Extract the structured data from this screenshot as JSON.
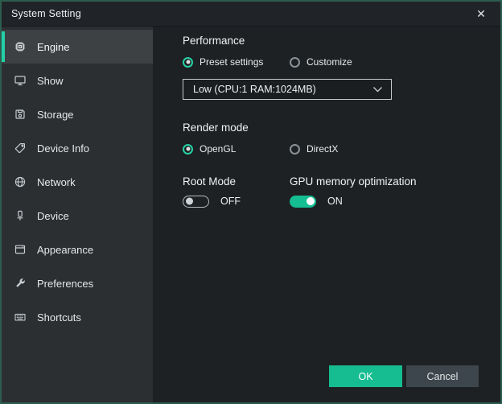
{
  "window": {
    "title": "System Setting",
    "close_icon": "✕"
  },
  "colors": {
    "accent": "#23d1a5",
    "ok_button": "#16bd90",
    "cancel_button": "#3d464d",
    "window_border": "#2c5d4e",
    "sidebar_bg": "#2b2f32",
    "main_bg": "#1d2124"
  },
  "sidebar": {
    "items": [
      {
        "label": "Engine",
        "icon": "engine-chip-icon",
        "selected": true
      },
      {
        "label": "Show",
        "icon": "monitor-icon",
        "selected": false
      },
      {
        "label": "Storage",
        "icon": "floppy-disk-icon",
        "selected": false
      },
      {
        "label": "Device Info",
        "icon": "tag-icon",
        "selected": false
      },
      {
        "label": "Network",
        "icon": "globe-icon",
        "selected": false
      },
      {
        "label": "Device",
        "icon": "usb-device-icon",
        "selected": false
      },
      {
        "label": "Appearance",
        "icon": "window-icon",
        "selected": false
      },
      {
        "label": "Preferences",
        "icon": "wrench-icon",
        "selected": false
      },
      {
        "label": "Shortcuts",
        "icon": "keyboard-icon",
        "selected": false
      }
    ]
  },
  "main": {
    "performance": {
      "title": "Performance",
      "radios": [
        {
          "label": "Preset settings",
          "selected": true
        },
        {
          "label": "Customize",
          "selected": false
        }
      ],
      "preset_dropdown": {
        "value": "Low (CPU:1 RAM:1024MB)"
      }
    },
    "render_mode": {
      "title": "Render mode",
      "radios": [
        {
          "label": "OpenGL",
          "selected": true
        },
        {
          "label": "DirectX",
          "selected": false
        }
      ]
    },
    "root_mode": {
      "label": "Root Mode",
      "state": "OFF",
      "on": false
    },
    "gpu_memory": {
      "label": "GPU memory optimization",
      "state": "ON",
      "on": true
    }
  },
  "footer": {
    "ok_label": "OK",
    "cancel_label": "Cancel"
  }
}
